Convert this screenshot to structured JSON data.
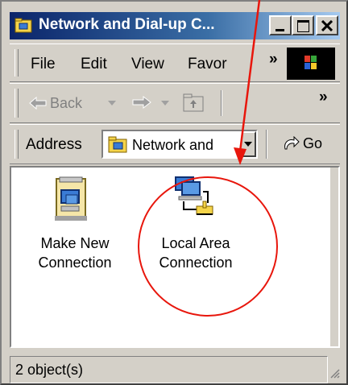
{
  "window": {
    "title": "Network and Dial-up C..."
  },
  "menubar": {
    "items": [
      "File",
      "Edit",
      "View",
      "Favor"
    ],
    "chevron": "»"
  },
  "toolbar": {
    "back_label": "Back",
    "chevron": "»"
  },
  "addressbar": {
    "label": "Address",
    "value": "Network and",
    "go_label": "Go"
  },
  "content": {
    "items": [
      {
        "label_line1": "Make New",
        "label_line2": "Connection",
        "icon": "make-new-connection-icon"
      },
      {
        "label_line1": "Local Area",
        "label_line2": "Connection",
        "icon": "local-area-connection-icon"
      }
    ]
  },
  "status": {
    "text": "2 object(s)"
  },
  "annotation": {
    "color": "#e8160c"
  }
}
